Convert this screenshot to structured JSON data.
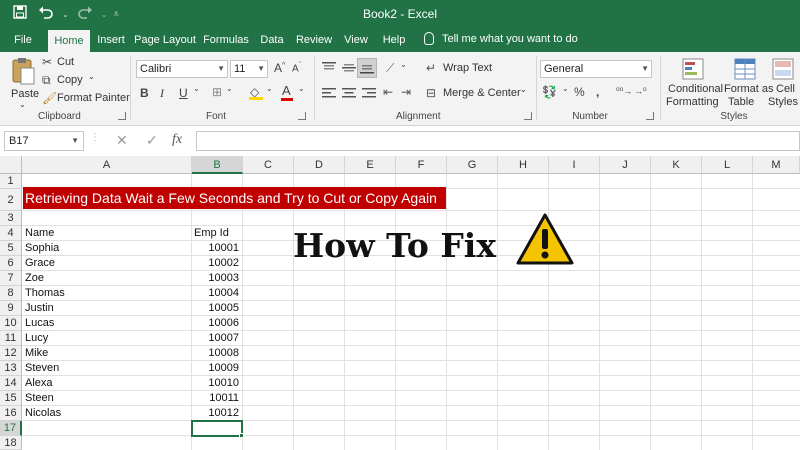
{
  "window": {
    "title": "Book2  -  Excel"
  },
  "qat": {
    "save_icon": "save-icon",
    "undo_icon": "undo-icon",
    "redo_icon": "redo-icon"
  },
  "tabs": [
    {
      "label": "File"
    },
    {
      "label": "Home"
    },
    {
      "label": "Insert"
    },
    {
      "label": "Page Layout"
    },
    {
      "label": "Formulas"
    },
    {
      "label": "Data"
    },
    {
      "label": "Review"
    },
    {
      "label": "View"
    },
    {
      "label": "Help"
    }
  ],
  "tell_me": "Tell me what you want to do",
  "ribbon": {
    "clipboard": {
      "label": "Clipboard",
      "paste": "Paste",
      "cut": "Cut",
      "copy": "Copy",
      "format_painter": "Format Painter"
    },
    "font": {
      "label": "Font",
      "font_name": "Calibri",
      "font_size": "11",
      "bold": "B",
      "italic": "I",
      "underline": "U",
      "grow": "A",
      "shrink": "A"
    },
    "alignment": {
      "label": "Alignment",
      "wrap_text": "Wrap Text",
      "merge_center": "Merge & Center"
    },
    "number": {
      "label": "Number",
      "format": "General"
    },
    "styles": {
      "label": "Styles",
      "conditional_1": "Conditional",
      "conditional_2": "Formatting",
      "format_as_1": "Format as",
      "format_as_2": "Table",
      "cell_1": "Cell",
      "cell_2": "Styles"
    }
  },
  "formula_bar": {
    "name_box": "B17",
    "content": ""
  },
  "columns": [
    "A",
    "B",
    "C",
    "D",
    "E",
    "F",
    "G",
    "H",
    "I",
    "J",
    "K",
    "L",
    "M"
  ],
  "rows": [
    "1",
    "2",
    "3",
    "4",
    "5",
    "6",
    "7",
    "8",
    "9",
    "10",
    "11",
    "12",
    "13",
    "14",
    "15",
    "16",
    "17",
    "18"
  ],
  "sheet": {
    "banner": "Retrieving Data Wait a Few Seconds and Try to Cut or Copy Again",
    "header_name": "Name",
    "header_emp": "Emp Id",
    "records": [
      {
        "name": "Sophia",
        "id": "10001"
      },
      {
        "name": "Grace",
        "id": "10002"
      },
      {
        "name": "Zoe",
        "id": "10003"
      },
      {
        "name": "Thomas",
        "id": "10004"
      },
      {
        "name": "Justin",
        "id": "10005"
      },
      {
        "name": "Lucas",
        "id": "10006"
      },
      {
        "name": "Lucy",
        "id": "10007"
      },
      {
        "name": "Mike",
        "id": "10008"
      },
      {
        "name": "Steven",
        "id": "10009"
      },
      {
        "name": "Alexa",
        "id": "10010"
      },
      {
        "name": "Steen",
        "id": "10011"
      },
      {
        "name": "Nicolas",
        "id": "10012"
      }
    ],
    "active_cell": "B17"
  },
  "overlay": {
    "headline": "How To Fix",
    "icon": "warning-icon",
    "icon_color": "#f5c400"
  },
  "colors": {
    "excel_green": "#217346",
    "banner_red": "#c00000"
  }
}
